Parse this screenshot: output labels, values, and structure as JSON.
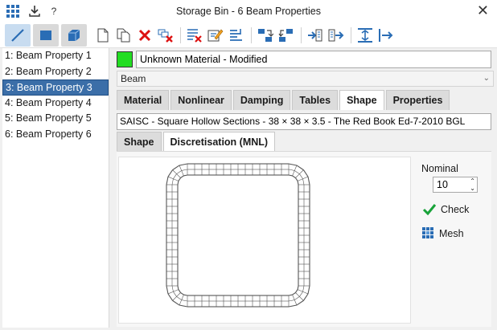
{
  "window": {
    "title": "Storage Bin - 6 Beam Properties"
  },
  "icons": {
    "app": "grid-app-icon",
    "download": "download-icon",
    "help": "?",
    "close": "close-icon"
  },
  "toolbar": {
    "tools": [
      "beam-element-icon",
      "plate-element-icon",
      "brick-element-icon",
      "new-icon",
      "copy-icon",
      "delete-icon",
      "delete-unused-icon",
      "clear-icon",
      "edit-icon",
      "sort-icon",
      "import-icon",
      "export-icon",
      "assign-icon",
      "select-icon",
      "align-icon",
      "offset-icon"
    ]
  },
  "properties": [
    "1: Beam Property 1",
    "2: Beam Property 2",
    "3: Beam Property 3",
    "4: Beam Property 4",
    "5: Beam Property 5",
    "6: Beam Property 6"
  ],
  "selected_index": 2,
  "material": {
    "name": "Unknown Material - Modified",
    "swatch_color": "#22dd22"
  },
  "type": "Beam",
  "main_tabs": [
    "Material",
    "Nonlinear",
    "Damping",
    "Tables",
    "Shape",
    "Properties"
  ],
  "main_tab_active": 4,
  "section": "SAISC - Square Hollow Sections - 38 × 38 × 3.5 - The Red Book Ed-7-2010 BGL",
  "sub_tabs": [
    "Shape",
    "Discretisation (MNL)"
  ],
  "sub_tab_active": 1,
  "discretisation": {
    "nominal_label": "Nominal",
    "nominal_value": "10",
    "check_label": "Check",
    "mesh_label": "Mesh"
  }
}
